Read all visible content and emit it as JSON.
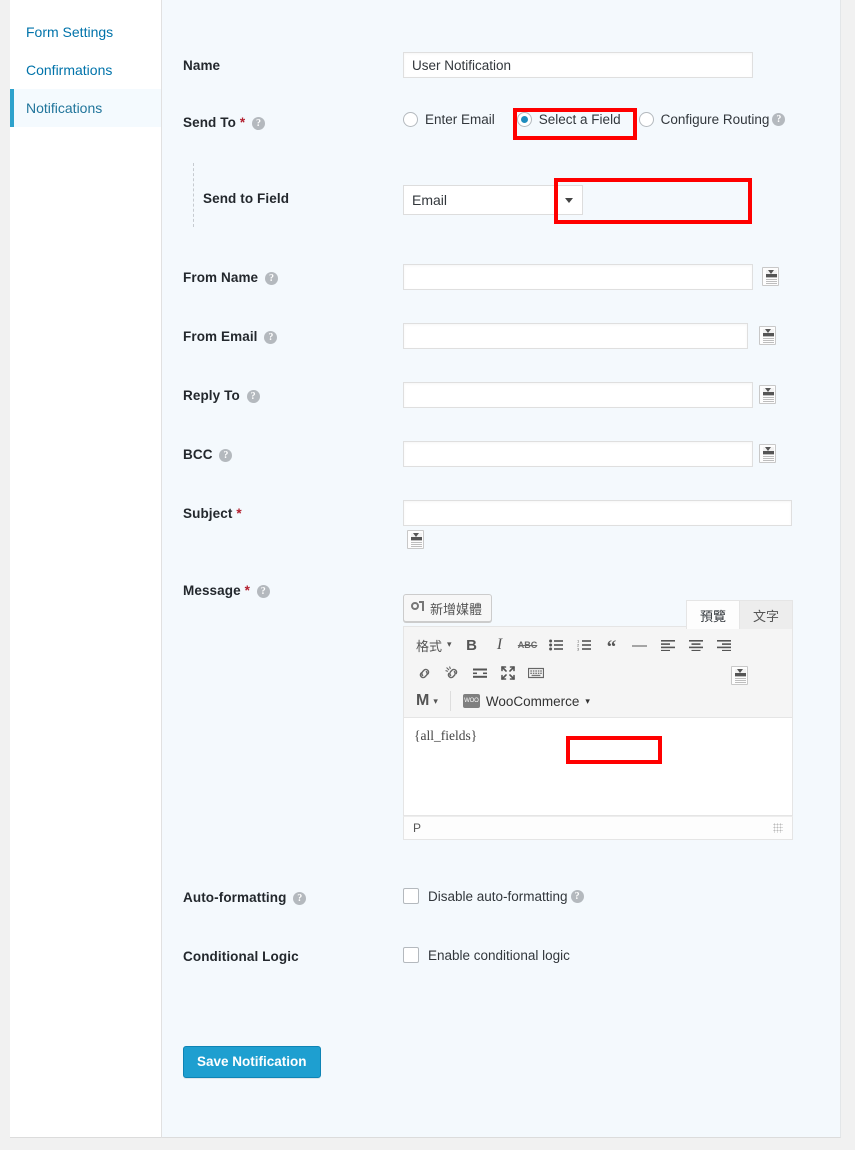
{
  "sidebar": {
    "items": [
      {
        "label": "Form Settings",
        "active": false
      },
      {
        "label": "Confirmations",
        "active": false
      },
      {
        "label": "Notifications",
        "active": true
      }
    ]
  },
  "form": {
    "name": {
      "label": "Name",
      "value": "User Notification"
    },
    "send_to": {
      "label": "Send To",
      "required_mark": "*",
      "help": "?",
      "options": [
        {
          "label": "Enter Email",
          "selected": false,
          "help": ""
        },
        {
          "label": "Select a Field",
          "selected": true,
          "help": ""
        },
        {
          "label": "Configure Routing",
          "selected": false,
          "help": "?"
        }
      ]
    },
    "send_to_field": {
      "label": "Send to Field",
      "value": "Email",
      "options": [
        "Email"
      ]
    },
    "from_name": {
      "label": "From Name",
      "help": "?",
      "value": "",
      "merge_tag": "merge-tag-icon"
    },
    "from_email": {
      "label": "From Email",
      "help": "?",
      "value": "",
      "merge_tag": "merge-tag-icon"
    },
    "reply_to": {
      "label": "Reply To",
      "help": "?",
      "value": "",
      "merge_tag": "merge-tag-icon"
    },
    "bcc": {
      "label": "BCC",
      "help": "?",
      "value": "",
      "merge_tag": "merge-tag-icon"
    },
    "subject": {
      "label": "Subject",
      "required_mark": "*",
      "value": "",
      "merge_tag": "merge-tag-icon"
    },
    "message": {
      "label": "Message",
      "required_mark": "*",
      "help": "?",
      "add_media_label": "新增媒體",
      "tabs": [
        {
          "label": "預覽",
          "active": true
        },
        {
          "label": "文字",
          "active": false
        }
      ],
      "toolbar": {
        "format_label": "格式",
        "bold": "B",
        "italic": "I",
        "strikethrough": "ABC",
        "bullet_list": "bullet-list-icon",
        "numbered_list": "numbered-list-icon",
        "blockquote": "“",
        "horizontal_rule": "—",
        "align_left": "align-left-icon",
        "align_center": "align-center-icon",
        "align_right": "align-right-icon",
        "insert_link": "link-icon",
        "remove_link": "unlink-icon",
        "read_more": "read-more-icon",
        "fullscreen": "fullscreen-icon",
        "toolbar_toggle": "keyboard-toolbar-icon",
        "mailchimp": "M",
        "woocommerce_label": "WooCommerce",
        "woocommerce_badge": "WOO"
      },
      "content": "{all_fields}",
      "status_path": "P",
      "merge_tag": "merge-tag-icon"
    },
    "auto_formatting": {
      "label": "Auto-formatting",
      "help": "?",
      "checkbox_label": "Disable auto-formatting",
      "checkbox_help": "?",
      "checked": false
    },
    "conditional_logic": {
      "label": "Conditional Logic",
      "checkbox_label": "Enable conditional logic",
      "checked": false
    },
    "save_button": "Save Notification"
  },
  "colors": {
    "accent": "#1e9fd0",
    "sidebar_link": "#0073aa",
    "panel_bg": "#f4f9fd",
    "annotation": "#ff0000",
    "required": "#b3202f"
  }
}
